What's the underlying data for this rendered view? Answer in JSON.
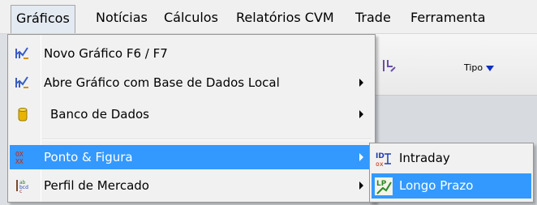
{
  "menubar": {
    "items": [
      "Gráficos",
      "Notícias",
      "Cálculos",
      "Relatórios CVM",
      "Trade",
      "Ferramenta"
    ]
  },
  "toolbar": {
    "tipo_label": "Tipo"
  },
  "menu": {
    "items": [
      {
        "label": "Novo Gráfico F6 / F7",
        "icon": "chart-icon",
        "submenu": false
      },
      {
        "label": "Abre Gráfico com Base de Dados Local",
        "icon": "chart-icon",
        "submenu": true
      },
      {
        "label": "Banco de Dados",
        "icon": "database-icon",
        "submenu": true
      },
      {
        "label": "Ponto  & Figura",
        "icon": "point-figure-icon",
        "submenu": true,
        "highlighted": true
      },
      {
        "label": "Perfil de Mercado",
        "icon": "market-profile-icon",
        "submenu": true
      }
    ]
  },
  "submenu": {
    "items": [
      {
        "label": "Intraday",
        "icon": "intraday-icon"
      },
      {
        "label": "Longo Prazo",
        "icon": "long-term-icon",
        "highlighted": true
      }
    ]
  },
  "colors": {
    "highlight": "#3399ff",
    "menu_bg": "#f1f1f1",
    "menubar_bg": "#f0f0f0"
  }
}
